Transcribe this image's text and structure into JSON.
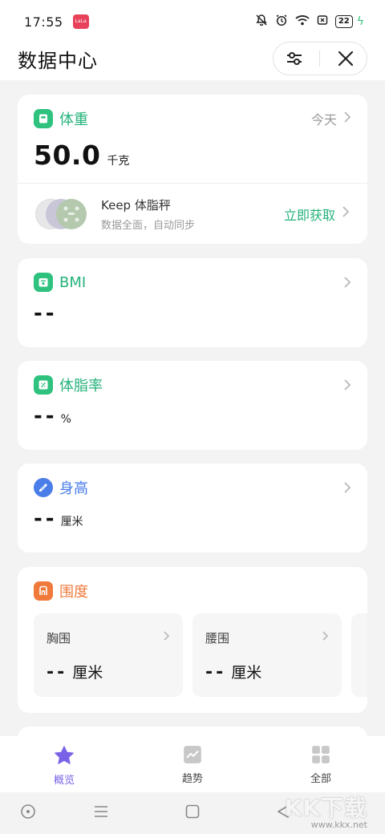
{
  "status_bar": {
    "time": "17:55",
    "app_badge": "LaLa",
    "battery": "22"
  },
  "header": {
    "title": "数据中心"
  },
  "weight": {
    "title": "体重",
    "today": "今天",
    "value": "50.0",
    "unit": "千克"
  },
  "keep": {
    "name": "Keep 体脂秤",
    "sub": "数据全面，自动同步",
    "action": "立即获取"
  },
  "bmi": {
    "title": "BMI",
    "value": "--"
  },
  "body_fat": {
    "title": "体脂率",
    "value": "--",
    "unit": "%"
  },
  "height": {
    "title": "身高",
    "value": "--",
    "unit": "厘米"
  },
  "girth": {
    "title": "围度",
    "items": [
      {
        "label": "胸围",
        "value": "--",
        "unit": "厘米"
      },
      {
        "label": "腰围",
        "value": "--",
        "unit": "厘米"
      }
    ]
  },
  "bottom_nav": {
    "items": [
      {
        "label": "概览"
      },
      {
        "label": "趋势"
      },
      {
        "label": "全部"
      }
    ]
  },
  "watermark": {
    "logo": "KK下载",
    "url": "www.kkx.net"
  },
  "colors": {
    "green": "#24b27a",
    "blue": "#4a7de8",
    "orange": "#ef7a3b",
    "purple": "#7a62e8"
  }
}
